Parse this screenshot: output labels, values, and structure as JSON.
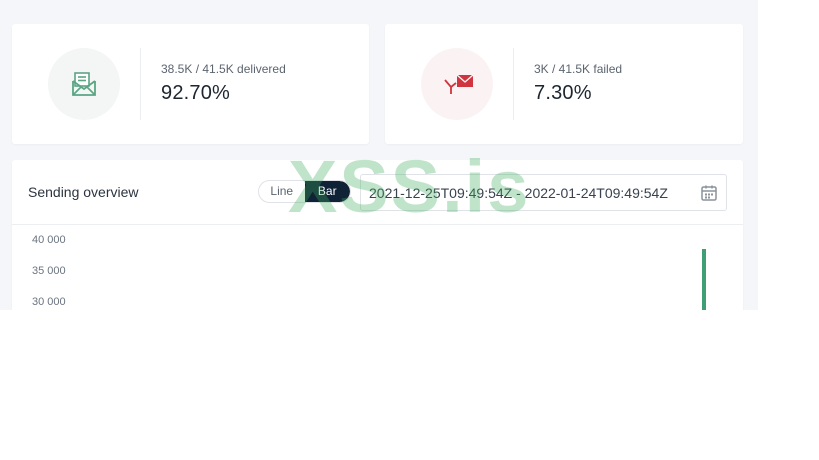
{
  "cards": {
    "delivered": {
      "icon": "envelope-open-icon",
      "subtitle": "38.5K / 41.5K delivered",
      "value": "92.70%",
      "accent": "#5aa584"
    },
    "failed": {
      "icon": "envelope-failed-icon",
      "subtitle": "3K / 41.5K failed",
      "value": "7.30%",
      "accent": "#d0343f"
    }
  },
  "overview": {
    "title": "Sending overview",
    "view_toggle": {
      "options": [
        "Line",
        "Bar"
      ],
      "selected": "Bar"
    },
    "date_range": "2021-12-25T09:49:54Z - 2022-01-24T09:49:54Z",
    "calendar_icon": "calendar-icon"
  },
  "chart_data": {
    "type": "bar",
    "y_ticks": [
      "40 000",
      "35 000",
      "30 000"
    ],
    "ylim": [
      30000,
      40000
    ],
    "bar_color": "#3f9e74",
    "series": [
      {
        "values": [
          38500
        ]
      }
    ]
  },
  "watermark": "XSS.is"
}
